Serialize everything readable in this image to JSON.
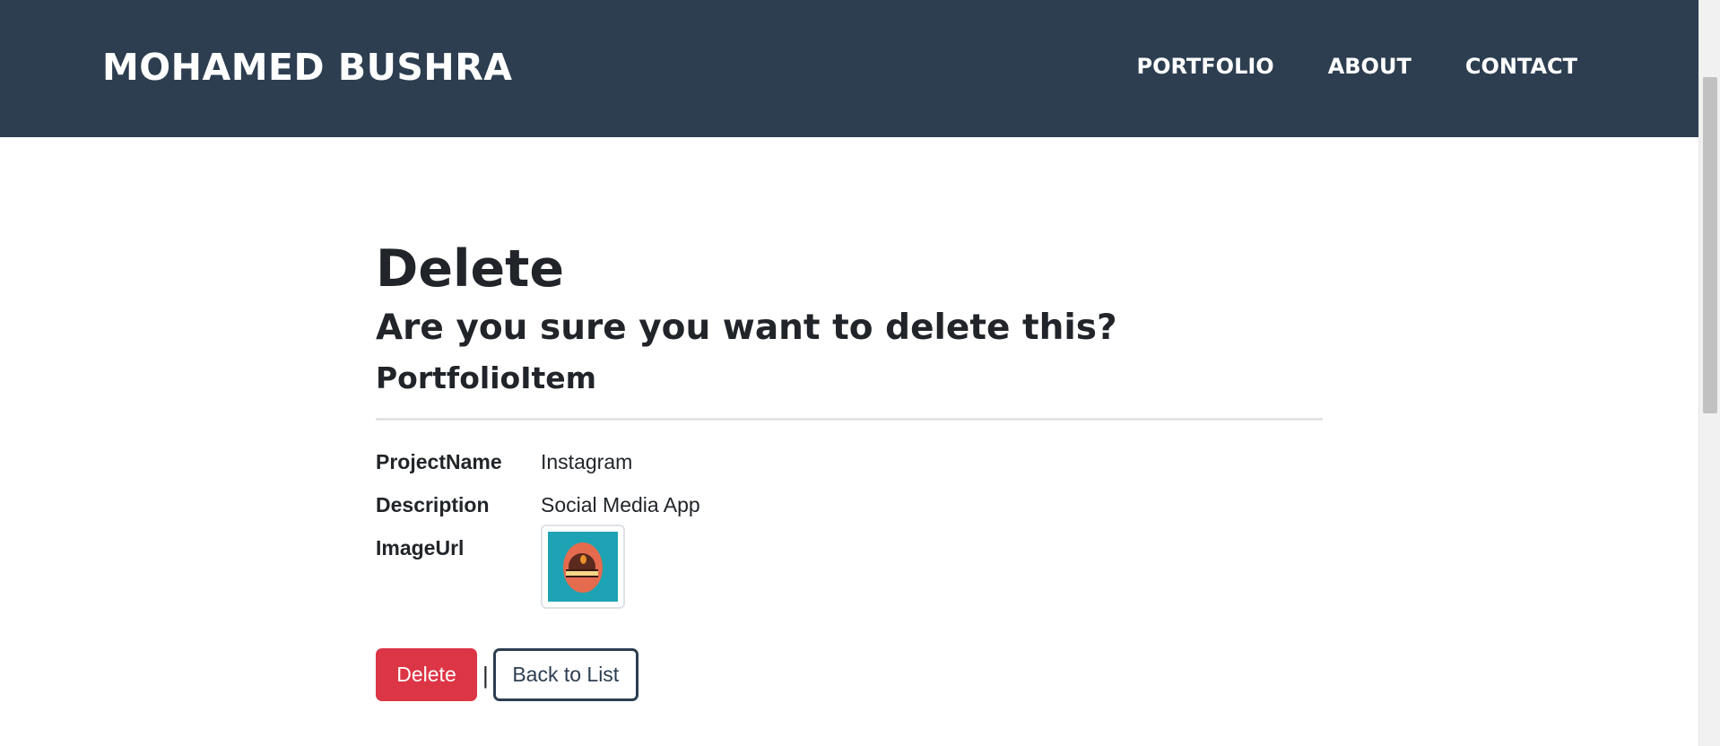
{
  "navbar": {
    "brand": "MOHAMED BUSHRA",
    "links": [
      "PORTFOLIO",
      "ABOUT",
      "CONTACT"
    ],
    "background": "#2c3e50"
  },
  "page": {
    "title": "Delete",
    "confirm_question": "Are you sure you want to delete this?",
    "model_name": "PortfolioItem"
  },
  "details": {
    "project_name": {
      "label": "ProjectName",
      "value": "Instagram"
    },
    "description": {
      "label": "Description",
      "value": "Social Media App"
    },
    "image_url": {
      "label": "ImageUrl",
      "image_icon": "portfolio-thumbnail-image"
    }
  },
  "actions": {
    "delete_label": "Delete",
    "separator": "|",
    "back_label": "Back to List",
    "delete_color": "#dc3545"
  }
}
